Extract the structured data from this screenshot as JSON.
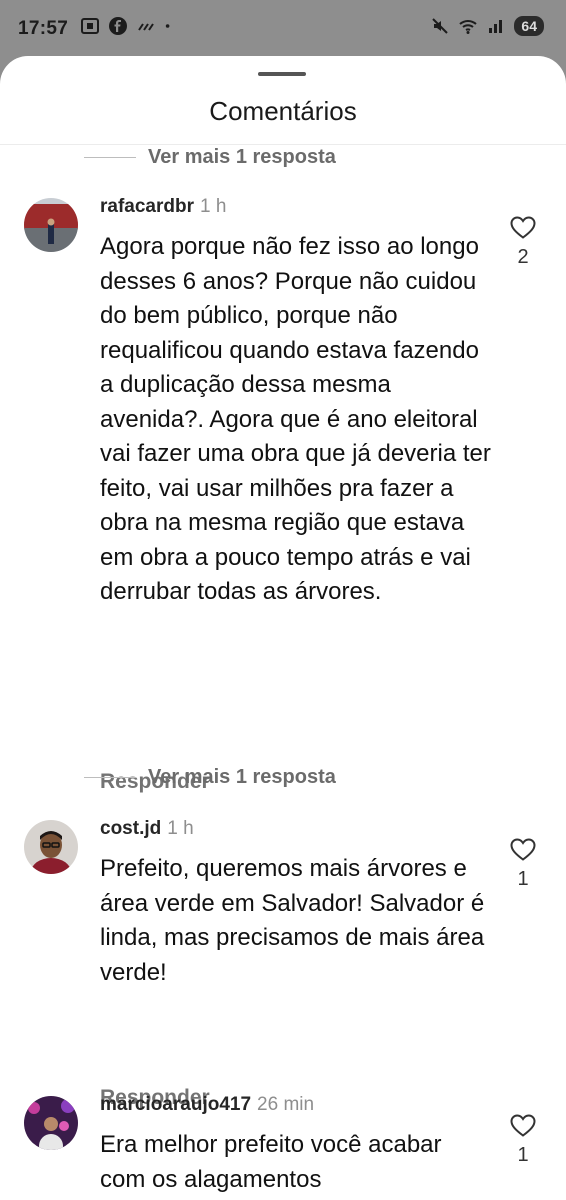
{
  "status_bar": {
    "time": "17:57",
    "left_icons": [
      "screenshot-icon",
      "facebook-icon",
      "signal-strength-icon",
      "dot-icon"
    ],
    "right_icons": [
      "mute-icon",
      "wifi-icon",
      "cell-signal-icon"
    ],
    "battery": "64"
  },
  "sheet": {
    "title": "Comentários"
  },
  "view_more_replies": "Ver mais 1 resposta",
  "reply_label": "Responder",
  "comments": [
    {
      "username": "rafacardbr",
      "time": "1 h",
      "text": "Agora porque não fez isso ao longo desses 6 anos? Porque não cuidou do bem público, porque não requalificou quando estava fazendo a duplicação dessa mesma avenida?. Agora que é ano eleitoral vai fazer uma obra que já deveria ter feito, vai usar milhões pra fazer a obra na mesma região que estava em obra a pouco tempo atrás e vai derrubar todas as árvores.",
      "likes": "2"
    },
    {
      "username": "cost.jd",
      "time": "1 h",
      "text": "Prefeito, queremos mais árvores e área verde em Salvador! Salvador é linda, mas precisamos de mais área verde!",
      "likes": "1"
    },
    {
      "username": "marcioaraujo417",
      "time": "26 min",
      "text": "Era melhor prefeito você acabar com os alagamentos",
      "likes": "1"
    }
  ],
  "colors": {
    "status_bar_bg": "#8e8e8e",
    "sheet_bg": "#ffffff",
    "secondary_text": "#737373"
  }
}
